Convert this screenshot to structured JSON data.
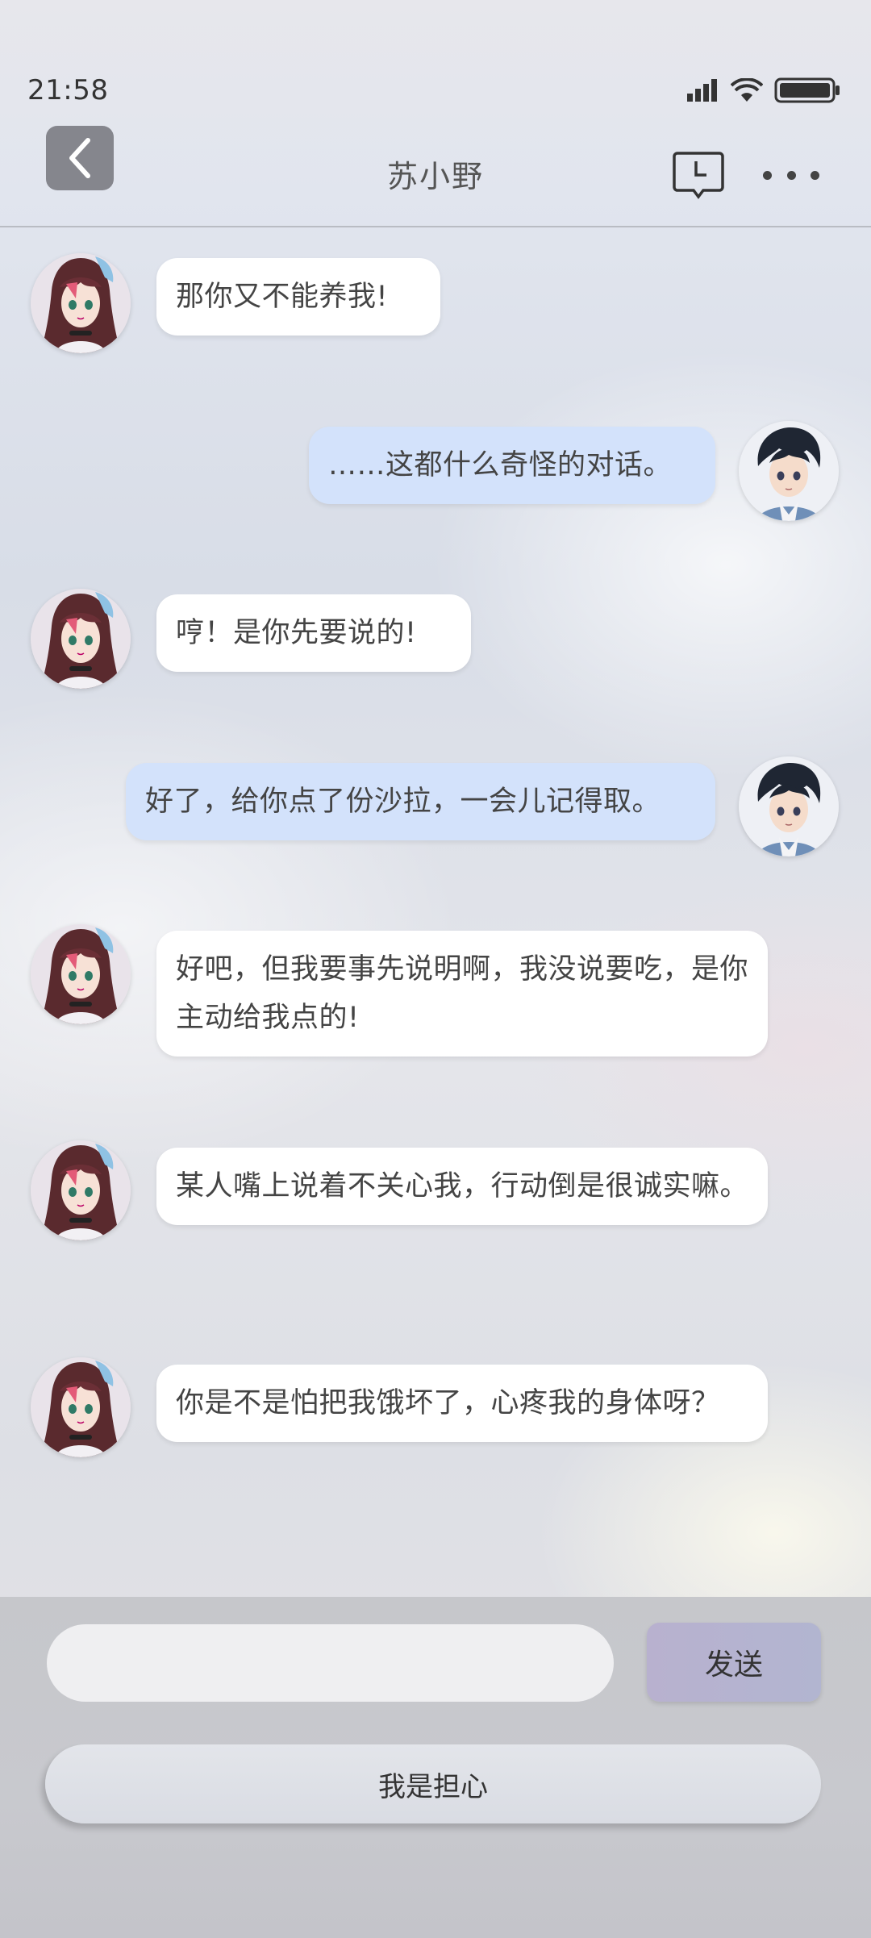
{
  "status_bar": {
    "time": "21:58"
  },
  "header": {
    "title": "苏小野"
  },
  "icons": {
    "back": "chevron-left-icon",
    "history": "clock-message-icon",
    "more": "more-dots-icon",
    "signal": "signal-icon",
    "wifi": "wifi-icon",
    "battery": "battery-icon"
  },
  "colors": {
    "left_bubble": "#ffffff",
    "right_bubble": "#d3e2fb",
    "back_button": "#85868d",
    "send_button": "#b5b3cf"
  },
  "messages": [
    {
      "side": "left",
      "text": "那你又不能养我!"
    },
    {
      "side": "right",
      "text": "……这都什么奇怪的对话。"
    },
    {
      "side": "left",
      "text": "哼！是你先要说的!"
    },
    {
      "side": "right",
      "text": "好了，给你点了份沙拉，一会儿记得取。"
    },
    {
      "side": "left",
      "text": "好吧，但我要事先说明啊，我没说要吃，是你主动给我点的!"
    },
    {
      "side": "left",
      "text": "某人嘴上说着不关心我，行动倒是很诚实嘛。"
    },
    {
      "side": "left",
      "text": "你是不是怕把我饿坏了，心疼我的身体呀？"
    }
  ],
  "composer": {
    "input_value": "",
    "send_label": "发送",
    "quick_reply_label": "我是担心"
  }
}
